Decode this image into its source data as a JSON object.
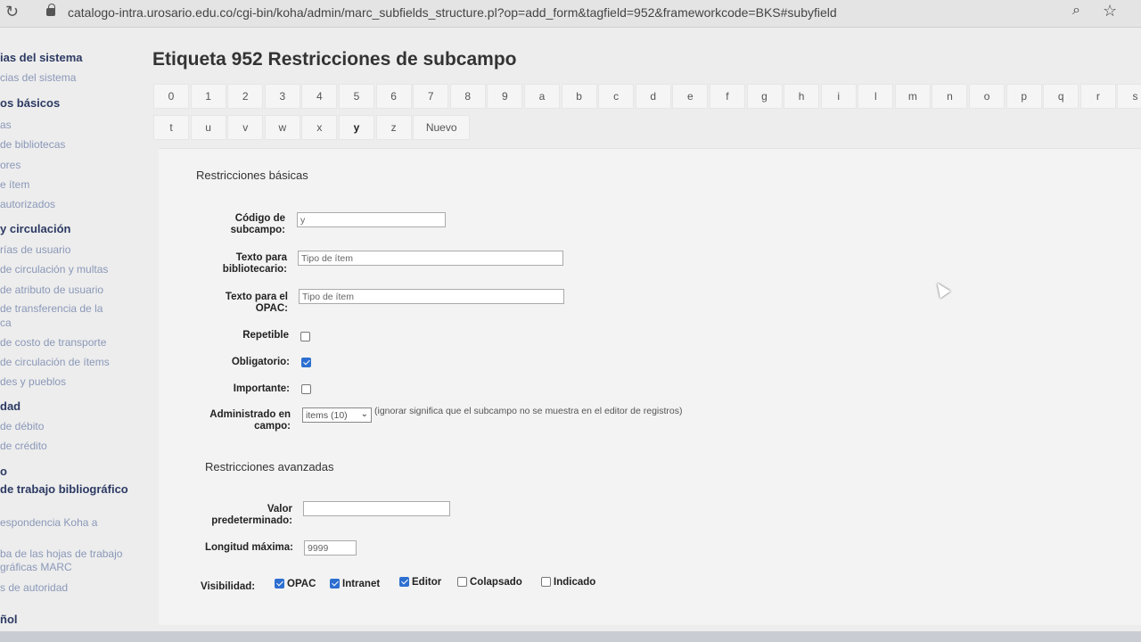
{
  "browser": {
    "url": "catalogo-intra.urosario.edu.co/cgi-bin/koha/admin/marc_subfields_structure.pl?op=add_form&tagfield=952&frameworkcode=BKS#subyfield"
  },
  "sidebar": {
    "items": [
      {
        "label": "ias del sistema",
        "type": "head"
      },
      {
        "label": "cias del sistema",
        "type": "link"
      },
      {
        "label": "os básicos",
        "type": "head"
      },
      {
        "label": "as",
        "type": "link"
      },
      {
        "label": "de bibliotecas",
        "type": "link"
      },
      {
        "label": "ores",
        "type": "link"
      },
      {
        "label": "e ítem",
        "type": "link"
      },
      {
        "label": "autorizados",
        "type": "link"
      },
      {
        "label": "y circulación",
        "type": "head"
      },
      {
        "label": "rías de usuario",
        "type": "link"
      },
      {
        "label": "de circulación y multas",
        "type": "link"
      },
      {
        "label": "de atributo de usuario",
        "type": "link"
      },
      {
        "label": "de transferencia de la",
        "type": "link"
      },
      {
        "label": "ca",
        "type": "link"
      },
      {
        "label": "de costo de transporte",
        "type": "link"
      },
      {
        "label": "de circulación de ítems",
        "type": "link"
      },
      {
        "label": "des y pueblos",
        "type": "link"
      },
      {
        "label": "dad",
        "type": "head"
      },
      {
        "label": "de débito",
        "type": "link"
      },
      {
        "label": "de crédito",
        "type": "link"
      },
      {
        "label": "o",
        "type": "head"
      },
      {
        "label": "de trabajo bibliográfico",
        "type": "head"
      },
      {
        "label": "espondencia Koha a",
        "type": "link"
      },
      {
        "label": "ba de las hojas de trabajo",
        "type": "link"
      },
      {
        "label": "gráficas MARC",
        "type": "link"
      },
      {
        "label": "s de autoridad",
        "type": "link"
      },
      {
        "label": "ñol",
        "type": "head"
      }
    ]
  },
  "page": {
    "title": "Etiqueta 952 Restricciones de subcampo"
  },
  "subfield_tabs": {
    "row1": [
      "0",
      "1",
      "2",
      "3",
      "4",
      "5",
      "6",
      "7",
      "8",
      "9",
      "a",
      "b",
      "c",
      "d",
      "e",
      "f",
      "g",
      "h",
      "i",
      "l",
      "m",
      "n",
      "o",
      "p",
      "q",
      "r",
      "s"
    ],
    "row2": [
      "t",
      "u",
      "v",
      "w",
      "x",
      "y",
      "z",
      "Nuevo"
    ],
    "active": "y"
  },
  "form": {
    "basic_title": "Restricciones básicas",
    "subfield_code_label": "Código de subcampo:",
    "subfield_code_value": "y",
    "librarian_text_label": "Texto para bibliotecario:",
    "librarian_text_value": "Tipo de ítem",
    "opac_text_label": "Texto para el OPAC:",
    "opac_text_value": "Tipo de ítem",
    "repeatable_label": "Repetible",
    "repeatable_checked": false,
    "mandatory_label": "Obligatorio:",
    "mandatory_checked": true,
    "important_label": "Importante:",
    "important_checked": false,
    "managed_label": "Administrado en campo:",
    "managed_value": "items (10)",
    "managed_hint": "(ignorar significa que el subcampo no se muestra en el editor de registros)",
    "advanced_title": "Restricciones avanzadas",
    "default_value_label": "Valor predeterminado:",
    "default_value": "",
    "max_length_label": "Longitud máxima:",
    "max_length_value": "9999",
    "visibility_label": "Visibilidad:",
    "visibility": [
      {
        "label": "OPAC",
        "checked": true
      },
      {
        "label": "Intranet",
        "checked": true
      },
      {
        "label": "Editor",
        "checked": true
      },
      {
        "label": "Colapsado",
        "checked": false
      },
      {
        "label": "Indicado",
        "checked": false
      }
    ]
  }
}
